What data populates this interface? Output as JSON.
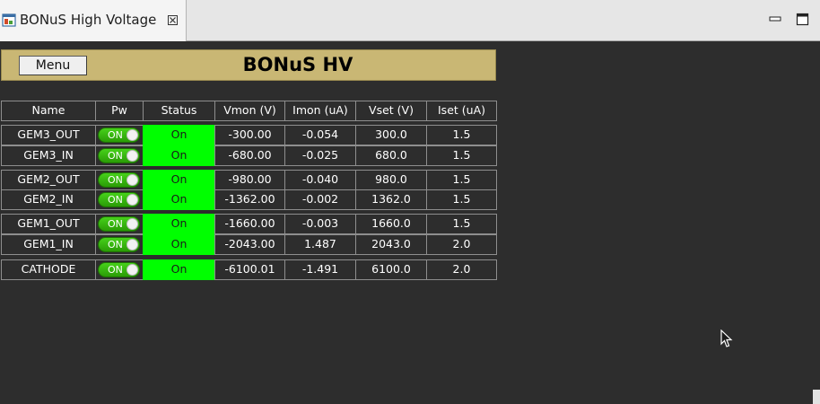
{
  "tab": {
    "title": "BONuS High Voltage",
    "close_glyph": "☒"
  },
  "header": {
    "menu_label": "Menu",
    "title": "BONuS HV",
    "bg_color": "#c9b774"
  },
  "table": {
    "columns": [
      "Name",
      "Pw",
      "Status",
      "Vmon (V)",
      "Imon (uA)",
      "Vset (V)",
      "Iset (uA)"
    ],
    "rows": [
      {
        "name": "GEM3_OUT",
        "pw": "ON",
        "status": "On",
        "vmon": "-300.00",
        "imon": "-0.054",
        "vset": "300.0",
        "iset": "1.5"
      },
      {
        "name": "GEM3_IN",
        "pw": "ON",
        "status": "On",
        "vmon": "-680.00",
        "imon": "-0.025",
        "vset": "680.0",
        "iset": "1.5"
      },
      {
        "name": "GEM2_OUT",
        "pw": "ON",
        "status": "On",
        "vmon": "-980.00",
        "imon": "-0.040",
        "vset": "980.0",
        "iset": "1.5"
      },
      {
        "name": "GEM2_IN",
        "pw": "ON",
        "status": "On",
        "vmon": "-1362.00",
        "imon": "-0.002",
        "vset": "1362.0",
        "iset": "1.5"
      },
      {
        "name": "GEM1_OUT",
        "pw": "ON",
        "status": "On",
        "vmon": "-1660.00",
        "imon": "-0.003",
        "vset": "1660.0",
        "iset": "1.5"
      },
      {
        "name": "GEM1_IN",
        "pw": "ON",
        "status": "On",
        "vmon": "-2043.00",
        "imon": "1.487",
        "vset": "2043.0",
        "iset": "2.0"
      },
      {
        "name": "CATHODE",
        "pw": "ON",
        "status": "On",
        "vmon": "-6100.01",
        "imon": "-1.491",
        "vset": "6100.0",
        "iset": "2.0"
      }
    ]
  },
  "colors": {
    "background": "#2d2d2d",
    "status_on": "#00ff00",
    "toggle_on": "#3cc010",
    "grid": "#8e8e8e"
  },
  "icons": {
    "tab": "window-icon",
    "close": "close-icon",
    "minimize": "minimize-icon",
    "maximize": "maximize-icon",
    "cursor": "mouse-cursor-icon"
  }
}
